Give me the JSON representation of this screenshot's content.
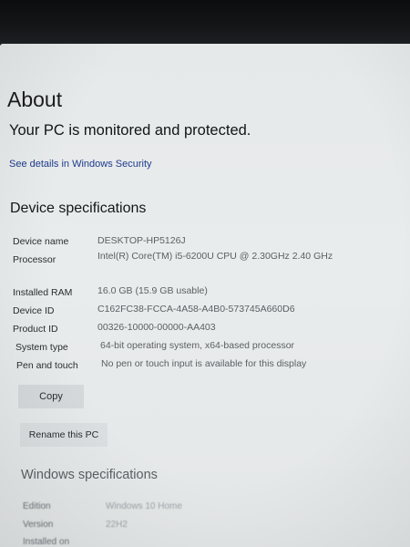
{
  "page": {
    "title": "About"
  },
  "security": {
    "status": "Your PC is monitored and protected.",
    "link": "See details in Windows Security"
  },
  "device_specs": {
    "heading": "Device specifications",
    "rows": [
      {
        "label": "Device name",
        "value": "DESKTOP-HP5126J"
      },
      {
        "label": "Processor",
        "value": "Intel(R) Core(TM) i5-6200U CPU @ 2.30GHz   2.40 GHz"
      },
      {
        "label": "Installed RAM",
        "value": "16.0 GB (15.9 GB usable)"
      },
      {
        "label": "Device ID",
        "value": "C162FC38-FCCA-4A58-A4B0-573745A660D6"
      },
      {
        "label": "Product ID",
        "value": "00326-10000-00000-AA403"
      },
      {
        "label": "System type",
        "value": "64-bit operating system, x64-based processor"
      },
      {
        "label": "Pen and touch",
        "value": "No pen or touch input is available for this display"
      }
    ],
    "copy_label": "Copy",
    "rename_label": "Rename this PC"
  },
  "windows_specs": {
    "heading": "Windows specifications",
    "rows": [
      {
        "label": "Edition",
        "value": "Windows 10 Home"
      },
      {
        "label": "Version",
        "value": "22H2"
      },
      {
        "label": "Installed on",
        "value": ""
      }
    ]
  }
}
